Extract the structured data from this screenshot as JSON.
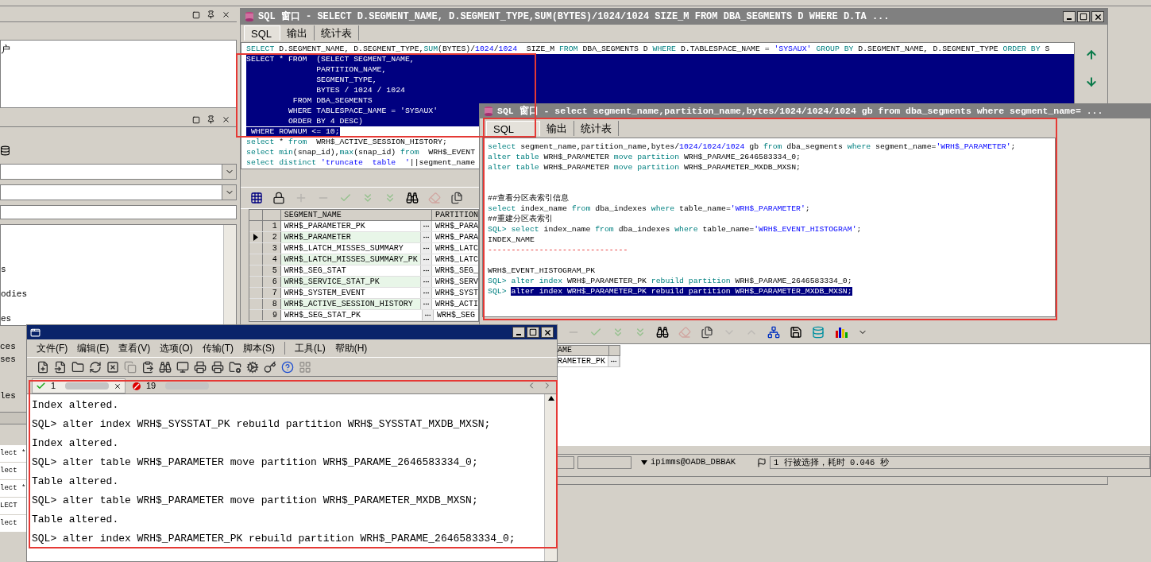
{
  "left_panel": {
    "tree_text": "户",
    "list_fragments": [
      "s",
      "odies",
      "es"
    ],
    "lower_fragments": [
      "ces",
      "ses",
      "les"
    ],
    "editor_fragments": [
      "lect *",
      "lect",
      "lect *",
      "LECT",
      "lect"
    ]
  },
  "sql_window_main": {
    "title": "SQL 窗口 - SELECT D.SEGMENT_NAME, D.SEGMENT_TYPE,SUM(BYTES)/1024/1024 SIZE_M FROM DBA_SEGMENTS D WHERE D.TA ...",
    "tabs": [
      {
        "label": "SQL",
        "selected": true
      },
      {
        "label": "输出",
        "selected": false
      },
      {
        "label": "统计表",
        "selected": false
      }
    ],
    "lines": [
      {
        "selected": false,
        "tokens": [
          {
            "kind": "keyword",
            "text": "SELECT"
          },
          {
            "kind": "plain",
            "text": " D.SEGMENT_NAME, D.SEGMENT_TYPE,"
          },
          {
            "kind": "keyword",
            "text": "SUM"
          },
          {
            "kind": "plain",
            "text": "(BYTES)/"
          },
          {
            "kind": "literal",
            "text": "1024"
          },
          {
            "kind": "plain",
            "text": "/"
          },
          {
            "kind": "literal",
            "text": "1024"
          },
          {
            "kind": "plain",
            "text": "  SIZE_M "
          },
          {
            "kind": "keyword",
            "text": "FROM"
          },
          {
            "kind": "plain",
            "text": " DBA_SEGMENTS D "
          },
          {
            "kind": "keyword",
            "text": "WHERE"
          },
          {
            "kind": "plain",
            "text": " D.TABLESPACE_NAME = "
          },
          {
            "kind": "literal",
            "text": "'SYSAUX' "
          },
          {
            "kind": "keyword",
            "text": "GROUP BY"
          },
          {
            "kind": "plain",
            "text": " D.SEGMENT_NAME, D.SEGMENT_TYPE "
          },
          {
            "kind": "keyword",
            "text": "ORDER BY"
          },
          {
            "kind": "plain",
            "text": " S"
          }
        ]
      },
      {
        "selected": true,
        "text": "SELECT * FROM  (SELECT SEGMENT_NAME,"
      },
      {
        "selected": true,
        "text": "               PARTITION_NAME,"
      },
      {
        "selected": true,
        "text": "               SEGMENT_TYPE,"
      },
      {
        "selected": true,
        "text": "               BYTES / 1024 / 1024"
      },
      {
        "selected": true,
        "text": "          FROM DBA_SEGMENTS"
      },
      {
        "selected": true,
        "text": "         WHERE TABLESPACE_NAME = 'SYSAUX'"
      },
      {
        "selected": true,
        "text": "         ORDER BY 4 DESC)"
      },
      {
        "selected": false,
        "tokens": [
          {
            "kind": "selected",
            "text": " WHERE ROWNUM <= 10;"
          }
        ]
      },
      {
        "selected": false,
        "tokens": [
          {
            "kind": "keyword",
            "text": "select"
          },
          {
            "kind": "plain",
            "text": " * "
          },
          {
            "kind": "keyword",
            "text": "from"
          },
          {
            "kind": "plain",
            "text": "  WRH$_ACTIVE_SESSION_HISTORY;"
          }
        ]
      },
      {
        "selected": false,
        "tokens": [
          {
            "kind": "keyword",
            "text": "select min"
          },
          {
            "kind": "plain",
            "text": "(snap_id),"
          },
          {
            "kind": "keyword",
            "text": "max"
          },
          {
            "kind": "plain",
            "text": "(snap_id) "
          },
          {
            "kind": "keyword",
            "text": "from"
          },
          {
            "kind": "plain",
            "text": "  WRH$_EVENT"
          }
        ]
      },
      {
        "selected": false,
        "tokens": [
          {
            "kind": "keyword",
            "text": "select distinct"
          },
          {
            "kind": "literal",
            "text": " 'truncate  table  '"
          },
          {
            "kind": "plain",
            "text": "||segment_name"
          }
        ]
      }
    ],
    "grid": {
      "columns": [
        "SEGMENT_NAME",
        "PARTITION"
      ],
      "rows": [
        {
          "number": "1",
          "name": "WRH$_PARAMETER_PK",
          "partition": "WRH$_PARA",
          "selected": false
        },
        {
          "number": "2",
          "name": "WRH$_PARAMETER",
          "partition": "WRH$_PARA",
          "selected": true
        },
        {
          "number": "3",
          "name": "WRH$_LATCH_MISSES_SUMMARY",
          "partition": "WRH$_LATC",
          "selected": false
        },
        {
          "number": "4",
          "name": "WRH$_LATCH_MISSES_SUMMARY_PK",
          "partition": "WRH$_LATC",
          "selected": false
        },
        {
          "number": "5",
          "name": "WRH$_SEG_STAT",
          "partition": "WRH$_SEG_",
          "selected": false
        },
        {
          "number": "6",
          "name": "WRH$_SERVICE_STAT_PK",
          "partition": "WRH$_SERV",
          "selected": false
        },
        {
          "number": "7",
          "name": "WRH$_SYSTEM_EVENT",
          "partition": "WRH$_SYST",
          "selected": false
        },
        {
          "number": "8",
          "name": "WRH$_ACTIVE_SESSION_HISTORY",
          "partition": "WRH$_ACTI",
          "selected": false
        },
        {
          "number": "9",
          "name": "WRH$_SEG_STAT_PK",
          "partition": "WRH$_SEG",
          "selected": false
        }
      ]
    }
  },
  "sql_window_second": {
    "title": "SQL 窗口 - select segment_name,partition_name,bytes/1024/1024/1024 gb from dba_segments where segment_name= ...",
    "tabs": [
      {
        "label": "SQL",
        "selected": true
      },
      {
        "label": "输出",
        "selected": false
      },
      {
        "label": "统计表",
        "selected": false
      }
    ],
    "lines": [
      {
        "kind": "code",
        "tokens": [
          {
            "kind": "keyword",
            "text": "select"
          },
          {
            "kind": "plain",
            "text": " segment_name,partition_name,bytes/"
          },
          {
            "kind": "literal",
            "text": "1024/1024/1024"
          },
          {
            "kind": "plain",
            "text": " gb "
          },
          {
            "kind": "keyword",
            "text": "from"
          },
          {
            "kind": "plain",
            "text": " dba_segments "
          },
          {
            "kind": "keyword",
            "text": "where"
          },
          {
            "kind": "plain",
            "text": " segment_name="
          },
          {
            "kind": "literal",
            "text": "'WRH$_PARAMETER'"
          },
          {
            "kind": "plain",
            "text": ";"
          }
        ]
      },
      {
        "kind": "code",
        "tokens": [
          {
            "kind": "keyword",
            "text": "alter table"
          },
          {
            "kind": "plain",
            "text": " WRH$_PARAMETER "
          },
          {
            "kind": "keyword",
            "text": "move partition"
          },
          {
            "kind": "plain",
            "text": " WRH$_PARAME_2646583334_0;"
          }
        ]
      },
      {
        "kind": "code",
        "tokens": [
          {
            "kind": "keyword",
            "text": "alter table"
          },
          {
            "kind": "plain",
            "text": " WRH$_PARAMETER "
          },
          {
            "kind": "keyword",
            "text": "move partition"
          },
          {
            "kind": "plain",
            "text": " WRH$_PARAMETER_MXDB_MXSN;"
          }
        ]
      },
      {
        "kind": "blank"
      },
      {
        "kind": "blank"
      },
      {
        "kind": "code",
        "tokens": [
          {
            "kind": "plain",
            "text": "##查看分区表索引信息"
          }
        ]
      },
      {
        "kind": "code",
        "tokens": [
          {
            "kind": "keyword",
            "text": "select"
          },
          {
            "kind": "plain",
            "text": " index_name "
          },
          {
            "kind": "keyword",
            "text": "from"
          },
          {
            "kind": "plain",
            "text": " dba_indexes "
          },
          {
            "kind": "keyword",
            "text": "where"
          },
          {
            "kind": "plain",
            "text": " table_name="
          },
          {
            "kind": "literal",
            "text": "'WRH$_PARAMETER'"
          },
          {
            "kind": "plain",
            "text": ";"
          }
        ]
      },
      {
        "kind": "code",
        "tokens": [
          {
            "kind": "plain",
            "text": "##重建分区表索引"
          }
        ]
      },
      {
        "kind": "code",
        "tokens": [
          {
            "kind": "keyword",
            "text": "SQL> select"
          },
          {
            "kind": "plain",
            "text": " index_name "
          },
          {
            "kind": "keyword",
            "text": "from"
          },
          {
            "kind": "plain",
            "text": " dba_indexes "
          },
          {
            "kind": "keyword",
            "text": "where"
          },
          {
            "kind": "plain",
            "text": " table_name="
          },
          {
            "kind": "literal",
            "text": "'WRH$_EVENT_HISTOGRAM'"
          },
          {
            "kind": "plain",
            "text": ";"
          }
        ]
      },
      {
        "kind": "code",
        "tokens": [
          {
            "kind": "plain",
            "text": "INDEX_NAME"
          }
        ]
      },
      {
        "kind": "code",
        "tokens": [
          {
            "kind": "rule",
            "text": "------------------------------"
          }
        ]
      },
      {
        "kind": "blank"
      },
      {
        "kind": "code",
        "tokens": [
          {
            "kind": "plain",
            "text": "WRH$_EVENT_HISTOGRAM_PK"
          }
        ]
      },
      {
        "kind": "code",
        "tokens": [
          {
            "kind": "keyword",
            "text": "SQL> alter index"
          },
          {
            "kind": "plain",
            "text": " WRH$_PARAMETER_PK "
          },
          {
            "kind": "keyword",
            "text": "rebuild partition"
          },
          {
            "kind": "plain",
            "text": " WRH$_PARAME_2646583334_0;"
          }
        ]
      },
      {
        "kind": "code",
        "tokens": [
          {
            "kind": "keyword",
            "text": "SQL> "
          },
          {
            "kind": "selected",
            "text": "alter index WRH$_PARAMETER_PK rebuild partition WRH$_PARAMETER_MXDB_MXSN;"
          }
        ]
      }
    ],
    "result_grid": {
      "column": "AME",
      "cell": "RAMETER_PK"
    },
    "status_bar": {
      "connection": "ipimms@OADB_DBBAK",
      "message": "1 行被选择，耗时 0.046 秒"
    }
  },
  "terminal": {
    "menu": [
      "文件(F)",
      "编辑(E)",
      "查看(V)",
      "选项(O)",
      "传输(T)",
      "脚本(S)",
      "工具(L)",
      "帮助(H)"
    ],
    "tabs": [
      {
        "label": "1",
        "selected": true,
        "kind": "connected"
      },
      {
        "label": "19",
        "selected": false,
        "kind": "disconnected"
      }
    ],
    "lines": [
      "Index altered.",
      "SQL> alter index WRH$_SYSSTAT_PK rebuild partition WRH$_SYSSTAT_MXDB_MXSN;",
      "Index altered.",
      "SQL> alter table WRH$_PARAMETER move partition WRH$_PARAME_2646583334_0;",
      "Table altered.",
      "SQL> alter table WRH$_PARAMETER move partition WRH$_PARAMETER_MXDB_MXSN;",
      "Table altered.",
      "SQL> alter index WRH$_PARAMETER_PK rebuild partition WRH$_PARAME_2646583334_0;"
    ]
  }
}
